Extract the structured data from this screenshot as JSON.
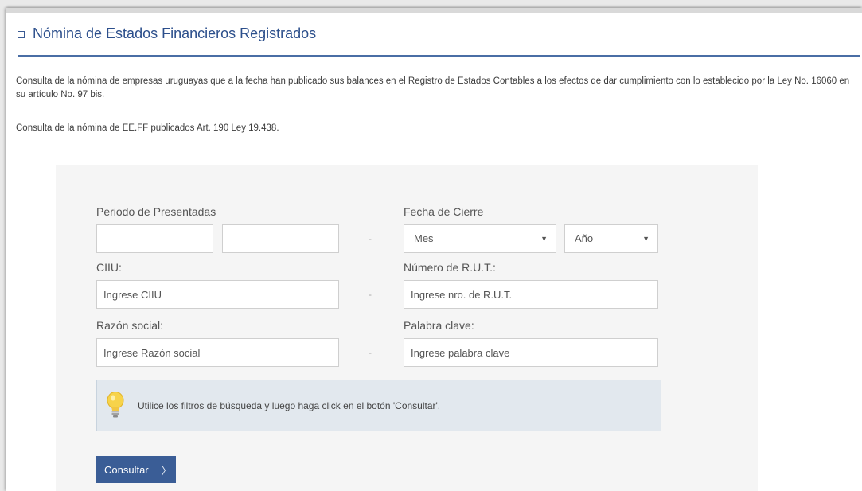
{
  "header": {
    "title": "Nómina de Estados Financieros Registrados"
  },
  "intro": {
    "paragraph1": "Consulta de la nómina de empresas uruguayas que a la fecha han publicado sus balances en el Registro de Estados Contables a los efectos de dar cumplimiento con lo establecido por la Ley No. 16060 en su artículo No. 97 bis.",
    "paragraph2": "Consulta de la nómina de EE.FF publicados Art. 190 Ley 19.438."
  },
  "form": {
    "periodo": {
      "label": "Periodo de Presentadas",
      "from_value": "",
      "to_value": ""
    },
    "fecha_cierre": {
      "label": "Fecha de Cierre",
      "mes_selected": "Mes",
      "anio_selected": "Año"
    },
    "ciiu": {
      "label": "CIIU:",
      "placeholder": "Ingrese CIIU"
    },
    "rut": {
      "label": "Número de R.U.T.:",
      "placeholder": "Ingrese nro. de R.U.T."
    },
    "razon_social": {
      "label": "Razón social:",
      "placeholder": "Ingrese Razón social"
    },
    "palabra_clave": {
      "label": "Palabra clave:",
      "placeholder": "Ingrese palabra clave"
    },
    "separator": "-",
    "dropdown_caret": "▼"
  },
  "info_box": {
    "icon": "lightbulb-icon",
    "text": "Utilice los filtros de búsqueda y luego haga click en el botón 'Consultar'."
  },
  "submit": {
    "label": "Consultar",
    "chevron": "〉"
  },
  "colors": {
    "accent": "#3a5d96",
    "title": "#2c4f8c",
    "panel_bg": "#f5f5f5",
    "info_bg": "#e2e8ee"
  }
}
